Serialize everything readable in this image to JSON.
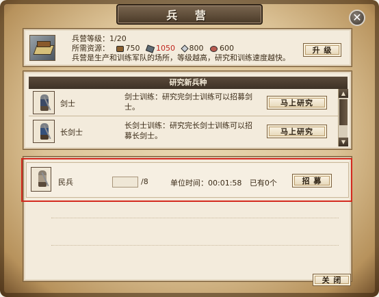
{
  "window": {
    "title": "兵 营",
    "close_symbol": "✕"
  },
  "barracks": {
    "level_label": "兵营等级：",
    "level_value": "1/20",
    "resources_label": "所需资源：",
    "resources": [
      {
        "icon": "wood-icon",
        "value": "750",
        "color": "#3a2a16"
      },
      {
        "icon": "stone-icon",
        "value": "1050",
        "color": "#c0241d"
      },
      {
        "icon": "iron-icon",
        "value": "800",
        "color": "#3a2a16"
      },
      {
        "icon": "food-icon",
        "value": "600",
        "color": "#3a2a16"
      }
    ],
    "description": "兵营是生产和训练军队的场所，等级越高，研究和训练速度越快。",
    "upgrade_label": "升 级"
  },
  "research": {
    "header": "研究新兵种",
    "units": [
      {
        "name": "剑士",
        "desc": "剑士训练：研究完剑士训练可以招募剑士。",
        "button": "马上研究"
      },
      {
        "name": "长剑士",
        "desc": "长剑士训练：研究完长剑士训练可以招募长剑士。",
        "button": "马上研究"
      }
    ],
    "scroll_up": "▲",
    "scroll_down": "▼"
  },
  "recruit": {
    "name": "民兵",
    "quantity": "",
    "max": "/8",
    "time_label": "单位时间：",
    "time_value": "00:01:58",
    "owned": "已有0个",
    "button": "招 募"
  },
  "footer": {
    "close_label": "关 闭"
  }
}
